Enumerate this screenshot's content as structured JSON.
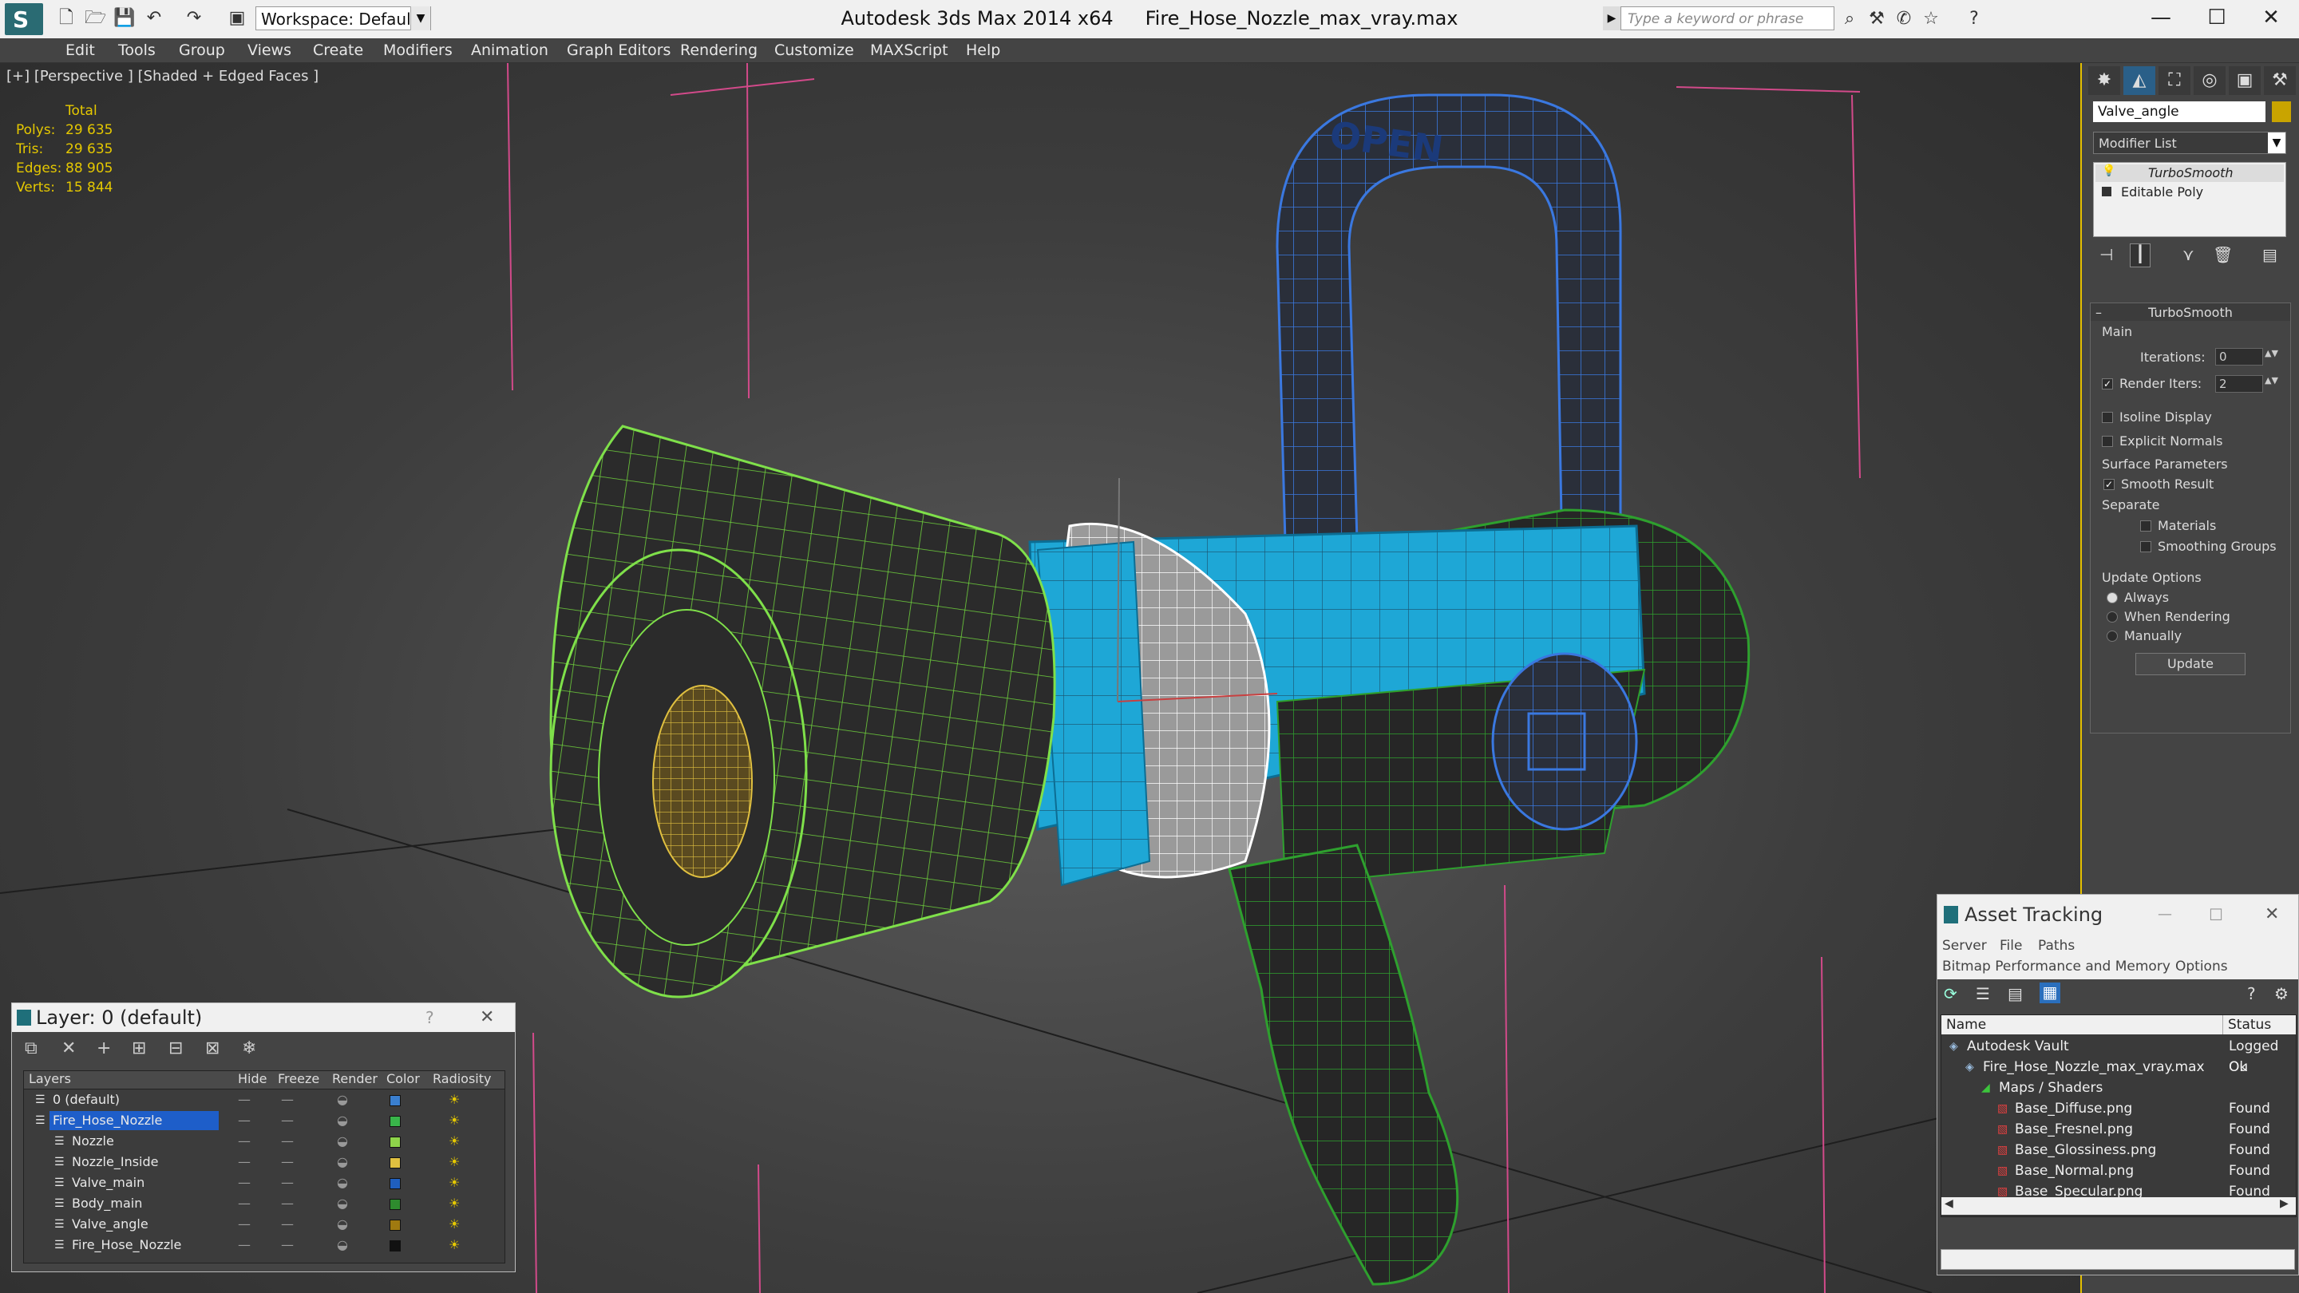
{
  "app": {
    "product": "Autodesk 3ds Max  2014 x64",
    "file": "Fire_Hose_Nozzle_max_vray.max",
    "workspace": "Workspace: Default",
    "search_placeholder": "Type a keyword or phrase"
  },
  "menu": [
    "Edit",
    "Tools",
    "Group",
    "Views",
    "Create",
    "Modifiers",
    "Animation",
    "Graph Editors",
    "Rendering",
    "Customize",
    "MAXScript",
    "Help"
  ],
  "viewport": {
    "label": "[+] [Perspective ] [Shaded + Edged Faces ]",
    "stats": {
      "header": "Total",
      "rows": [
        {
          "label": "Polys:",
          "value": "29 635"
        },
        {
          "label": "Tris:",
          "value": "29 635"
        },
        {
          "label": "Edges:",
          "value": "88 905"
        },
        {
          "label": "Verts:",
          "value": "15 844"
        }
      ]
    },
    "handle_text": "OPEN"
  },
  "command_panel": {
    "object_name": "Valve_angle",
    "modifier_list": "Modifier List",
    "stack": [
      "TurboSmooth",
      "Editable Poly"
    ],
    "rollout_title": "TurboSmooth",
    "main_label": "Main",
    "iterations_label": "Iterations:",
    "iterations_value": "0",
    "render_iters_label": "Render Iters:",
    "render_iters_value": "2",
    "isoline_label": "Isoline Display",
    "explicit_normals_label": "Explicit Normals",
    "surface_params_label": "Surface Parameters",
    "smooth_result_label": "Smooth Result",
    "separate_label": "Separate",
    "materials_label": "Materials",
    "smoothing_groups_label": "Smoothing Groups",
    "update_options_label": "Update Options",
    "always_label": "Always",
    "when_rendering_label": "When Rendering",
    "manually_label": "Manually",
    "update_button": "Update"
  },
  "layer_dialog": {
    "title": "Layer: 0 (default)",
    "help": "?",
    "columns": [
      "Layers",
      "Hide",
      "Freeze",
      "Render",
      "Color",
      "Radiosity"
    ],
    "rows": [
      {
        "name": "0 (default)",
        "color": "#3a7fd0",
        "indent": 1,
        "selected": false
      },
      {
        "name": "Fire_Hose_Nozzle",
        "color": "#39b54a",
        "indent": 1,
        "selected": true
      },
      {
        "name": "Nozzle",
        "color": "#8ed44a",
        "indent": 2,
        "selected": false
      },
      {
        "name": "Nozzle_Inside",
        "color": "#e0c040",
        "indent": 2,
        "selected": false
      },
      {
        "name": "Valve_main",
        "color": "#1f5fbf",
        "indent": 2,
        "selected": false
      },
      {
        "name": "Body_main",
        "color": "#2e8b2e",
        "indent": 2,
        "selected": false
      },
      {
        "name": "Valve_angle",
        "color": "#a07a10",
        "indent": 2,
        "selected": false
      },
      {
        "name": "Fire_Hose_Nozzle",
        "color": "#111111",
        "indent": 2,
        "selected": false
      }
    ]
  },
  "asset_tracking": {
    "title": "Asset Tracking",
    "menu": [
      "Server",
      "File",
      "Paths"
    ],
    "menu2": [
      "Bitmap Performance and Memory",
      "Options"
    ],
    "columns": [
      "Name",
      "Status"
    ],
    "rows": [
      {
        "name": "Autodesk Vault",
        "status": "Logged Ou",
        "indent": 0
      },
      {
        "name": "Fire_Hose_Nozzle_max_vray.max",
        "status": "Ok",
        "indent": 1
      },
      {
        "name": "Maps / Shaders",
        "status": "",
        "indent": 2
      },
      {
        "name": "Base_Diffuse.png",
        "status": "Found",
        "indent": 3
      },
      {
        "name": "Base_Fresnel.png",
        "status": "Found",
        "indent": 3
      },
      {
        "name": "Base_Glossiness.png",
        "status": "Found",
        "indent": 3
      },
      {
        "name": "Base_Normal.png",
        "status": "Found",
        "indent": 3
      },
      {
        "name": "Base_Specular.png",
        "status": "Found",
        "indent": 3
      }
    ]
  },
  "colors": {
    "accent_yellow": "#e5c800",
    "wire_green": "#7fe04a",
    "wire_blue": "#3a78e0",
    "body_cyan": "#1ea7d6",
    "selection_blue": "#1e5ec9"
  }
}
